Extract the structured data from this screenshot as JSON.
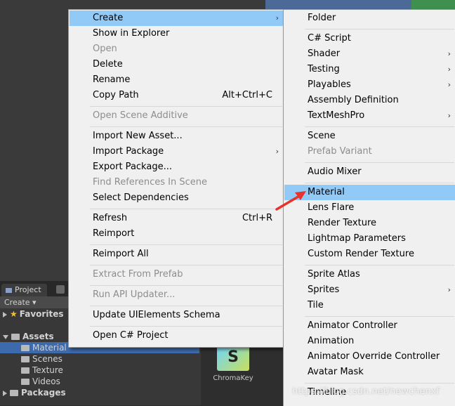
{
  "project_panel": {
    "tab_label": "Project",
    "create_label": "Create ▾",
    "tree": [
      {
        "label": "Favorites",
        "icon": "star-icon",
        "expanded": false
      },
      {
        "label": "Assets",
        "icon": "folder-icon",
        "expanded": true
      },
      {
        "label": "Material",
        "icon": "folder-icon",
        "selected": true
      },
      {
        "label": "Scenes",
        "icon": "folder-icon"
      },
      {
        "label": "Texture",
        "icon": "folder-icon"
      },
      {
        "label": "Videos",
        "icon": "folder-icon"
      },
      {
        "label": "Packages",
        "icon": "folder-icon",
        "expanded": false
      }
    ],
    "asset": {
      "thumb_letter": "S",
      "label": "ChromaKey"
    }
  },
  "context_menu": {
    "items": [
      {
        "label": "Create",
        "highlight": true,
        "submenu": true
      },
      {
        "label": "Show in Explorer"
      },
      {
        "label": "Open",
        "disabled": true
      },
      {
        "label": "Delete"
      },
      {
        "label": "Rename"
      },
      {
        "label": "Copy Path",
        "shortcut": "Alt+Ctrl+C"
      },
      {
        "label": "Open Scene Additive",
        "disabled": true
      },
      {
        "label": "Import New Asset..."
      },
      {
        "label": "Import Package",
        "submenu": true
      },
      {
        "label": "Export Package..."
      },
      {
        "label": "Find References In Scene",
        "disabled": true
      },
      {
        "label": "Select Dependencies"
      },
      {
        "label": "Refresh",
        "shortcut": "Ctrl+R"
      },
      {
        "label": "Reimport"
      },
      {
        "label": "Reimport All"
      },
      {
        "label": "Extract From Prefab",
        "disabled": true
      },
      {
        "label": "Run API Updater...",
        "disabled": true
      },
      {
        "label": "Update UIElements Schema"
      },
      {
        "label": "Open C# Project"
      }
    ]
  },
  "create_submenu": {
    "items": [
      {
        "label": "Folder"
      },
      {
        "label": "C# Script"
      },
      {
        "label": "Shader",
        "submenu": true
      },
      {
        "label": "Testing",
        "submenu": true
      },
      {
        "label": "Playables",
        "submenu": true
      },
      {
        "label": "Assembly Definition"
      },
      {
        "label": "TextMeshPro",
        "submenu": true
      },
      {
        "label": "Scene"
      },
      {
        "label": "Prefab Variant",
        "disabled": true
      },
      {
        "label": "Audio Mixer"
      },
      {
        "label": "Material",
        "highlight": true
      },
      {
        "label": "Lens Flare"
      },
      {
        "label": "Render Texture"
      },
      {
        "label": "Lightmap Parameters"
      },
      {
        "label": "Custom Render Texture"
      },
      {
        "label": "Sprite Atlas"
      },
      {
        "label": "Sprites",
        "submenu": true
      },
      {
        "label": "Tile"
      },
      {
        "label": "Animator Controller"
      },
      {
        "label": "Animation"
      },
      {
        "label": "Animator Override Controller"
      },
      {
        "label": "Avatar Mask"
      },
      {
        "label": "Timeline"
      }
    ]
  },
  "colors": {
    "highlight": "#91c9f7",
    "menu_bg": "#f0f0f0",
    "arrow": "#e8322a"
  },
  "watermark": "https://blog.csdn.net/newchenxf"
}
